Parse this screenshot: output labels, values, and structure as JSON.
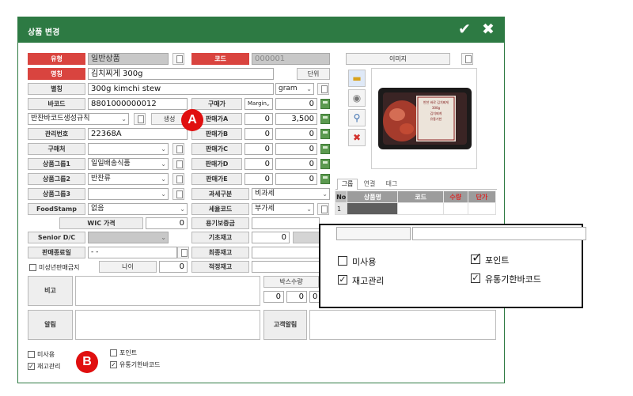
{
  "window": {
    "title": "상품 변경"
  },
  "labels": {
    "type": "유형",
    "name": "명칭",
    "alias": "별칭",
    "barcode": "바코드",
    "manage_no": "관리번호",
    "supplier": "구매처",
    "group1": "상품그룹1",
    "group2": "상품그룹2",
    "group3": "상품그룹3",
    "foodstamp": "FoodStamp",
    "wic_price": "WIC 가격",
    "senior": "Senior D/C",
    "sale_end": "판매종료일",
    "minor_ban": "미성년판매금지",
    "age": "나이",
    "code": "코드",
    "unit": "단위",
    "purchase_price": "구매가",
    "price_a": "판매가A",
    "price_b": "판매가B",
    "price_c": "판매가C",
    "price_d": "판매가D",
    "price_e": "판매가E",
    "tax_type": "과세구분",
    "tax_code": "세율코드",
    "deposit": "용기보증금",
    "base_stock": "기초재고",
    "final_stock": "최종재고",
    "optimal_stock": "적정재고",
    "box_qty": "박스수량",
    "note": "비고",
    "alert": "알림",
    "customer_alert": "고객알림",
    "image": "이미지",
    "generate": "생성"
  },
  "values": {
    "type": "일반상품",
    "code": "000001",
    "name": "김치찌게 300g",
    "alias": "300g kimchi stew",
    "unit": "gram",
    "barcode": "8801000000012",
    "barcode_rule": "반찬바코드생성규칙",
    "margin": "Margin",
    "purchase_price": "0",
    "price_a": "0",
    "price_a2": "3,500",
    "manage_no": "22368A",
    "price_b": "0",
    "price_b2": "0",
    "price_c": "0",
    "price_c2": "0",
    "group1": "일일배송식품",
    "price_d": "0",
    "price_d2": "0",
    "group2": "반찬류",
    "price_e": "0",
    "price_e2": "0",
    "tax_type": "비과세",
    "foodstamp": "없음",
    "tax_code": "부가세",
    "wic_price": "0",
    "base_stock": "0",
    "sale_end": "- -",
    "age": "0",
    "box_qty1": "0",
    "box_qty2": "0",
    "box_qty3": "0"
  },
  "tabs": [
    "그룹",
    "연결",
    "태그"
  ],
  "table": {
    "headers": [
      "No",
      "상품명",
      "코드",
      "수량",
      "단가"
    ],
    "rows": [
      [
        "1",
        "",
        "",
        "",
        ""
      ]
    ]
  },
  "checks": {
    "unused": "미사용",
    "stock": "재고관리",
    "point": "포인트",
    "expiry": "유통기한바코드",
    "unused_on": false,
    "stock_on": true,
    "point_on": false,
    "expiry_on": true
  },
  "zoom": {
    "unused": "미사용",
    "stock": "재고관리",
    "point": "포인트",
    "expiry": "유통기한바코드"
  },
  "badges": {
    "a": "A",
    "b": "B"
  },
  "product_label": [
    "반찬 바로 김치찌게",
    "300g",
    "김치찌게",
    "유통기한"
  ],
  "colors": {
    "title_green": "#2d7a43",
    "label_red": "#d9443f",
    "badge_red": "#e00f0f"
  },
  "icons": [
    "check-icon",
    "close-icon",
    "folder-icon",
    "camera-icon",
    "zoom-icon",
    "delete-icon",
    "document-icon",
    "calculator-icon",
    "calendar-icon",
    "chevron-down-icon"
  ]
}
